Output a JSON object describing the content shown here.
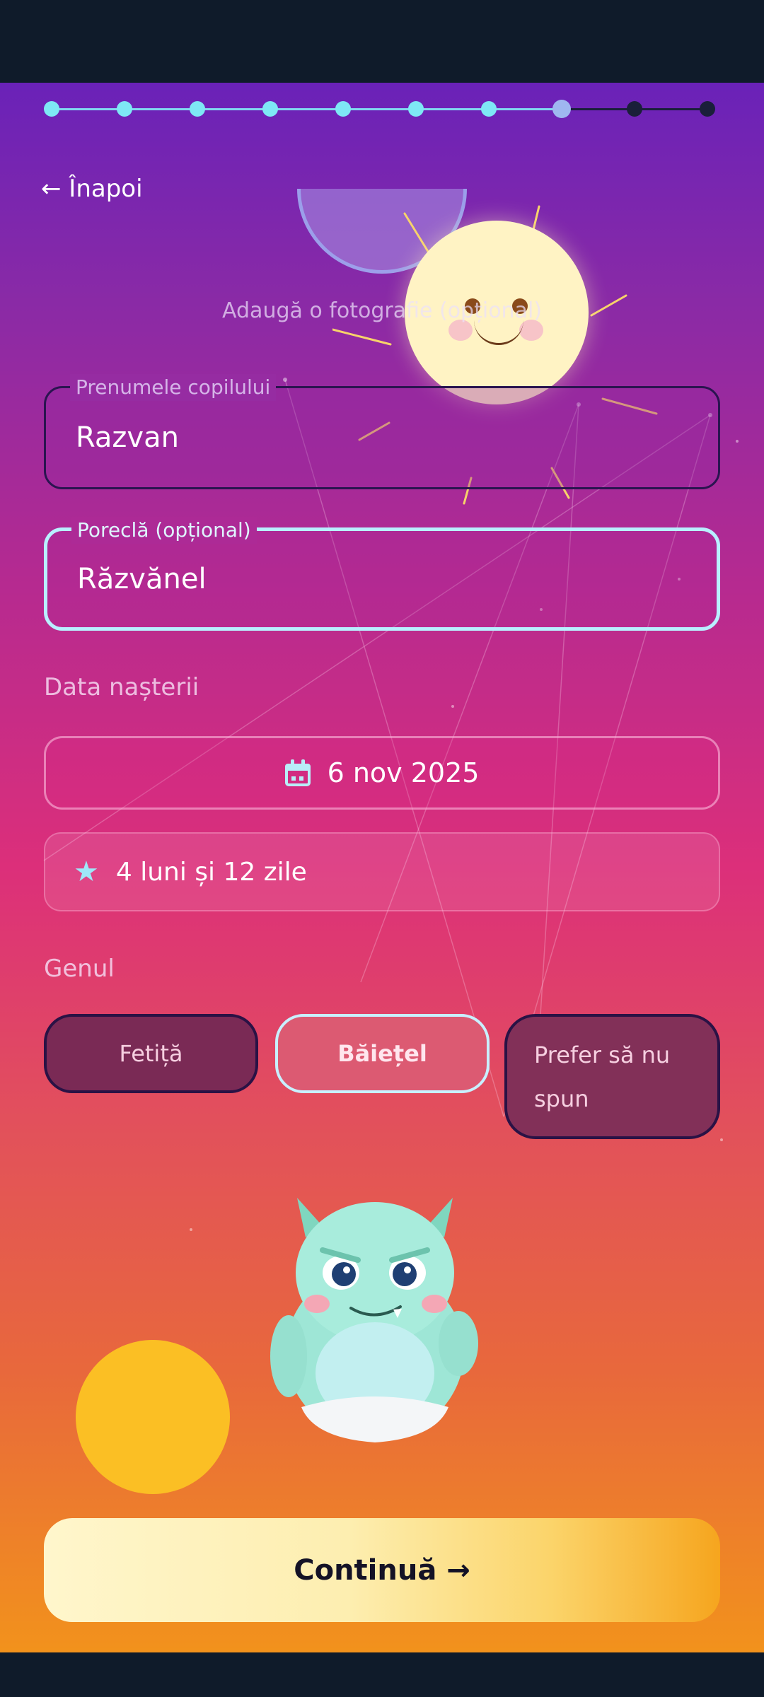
{
  "progress": {
    "total_steps": 10,
    "current_step": 8
  },
  "nav": {
    "back_label": "← Înapoi"
  },
  "photo": {
    "label": "Adaugă o fotografie (opțional)"
  },
  "form": {
    "first_name": {
      "label": "Prenumele copilului",
      "value": "Razvan"
    },
    "nickname": {
      "label": "Poreclă (opțional)",
      "value": "Răzvănel"
    },
    "birth_date": {
      "section_label": "Data nașterii",
      "value": "6 nov 2025"
    },
    "age": {
      "value": "4 luni și 12 zile",
      "icon": "star-icon"
    },
    "gender": {
      "section_label": "Genul",
      "options": [
        "Fetiță",
        "Băiețel",
        "Prefer să nu spun"
      ],
      "selected": "Băiețel"
    }
  },
  "footer": {
    "continue_label": "Continuă →"
  },
  "colors": {
    "accent_cyan": "#7ee8f5",
    "continue_gradient_end": "#f6a51e",
    "sun": "#fff3c4"
  }
}
